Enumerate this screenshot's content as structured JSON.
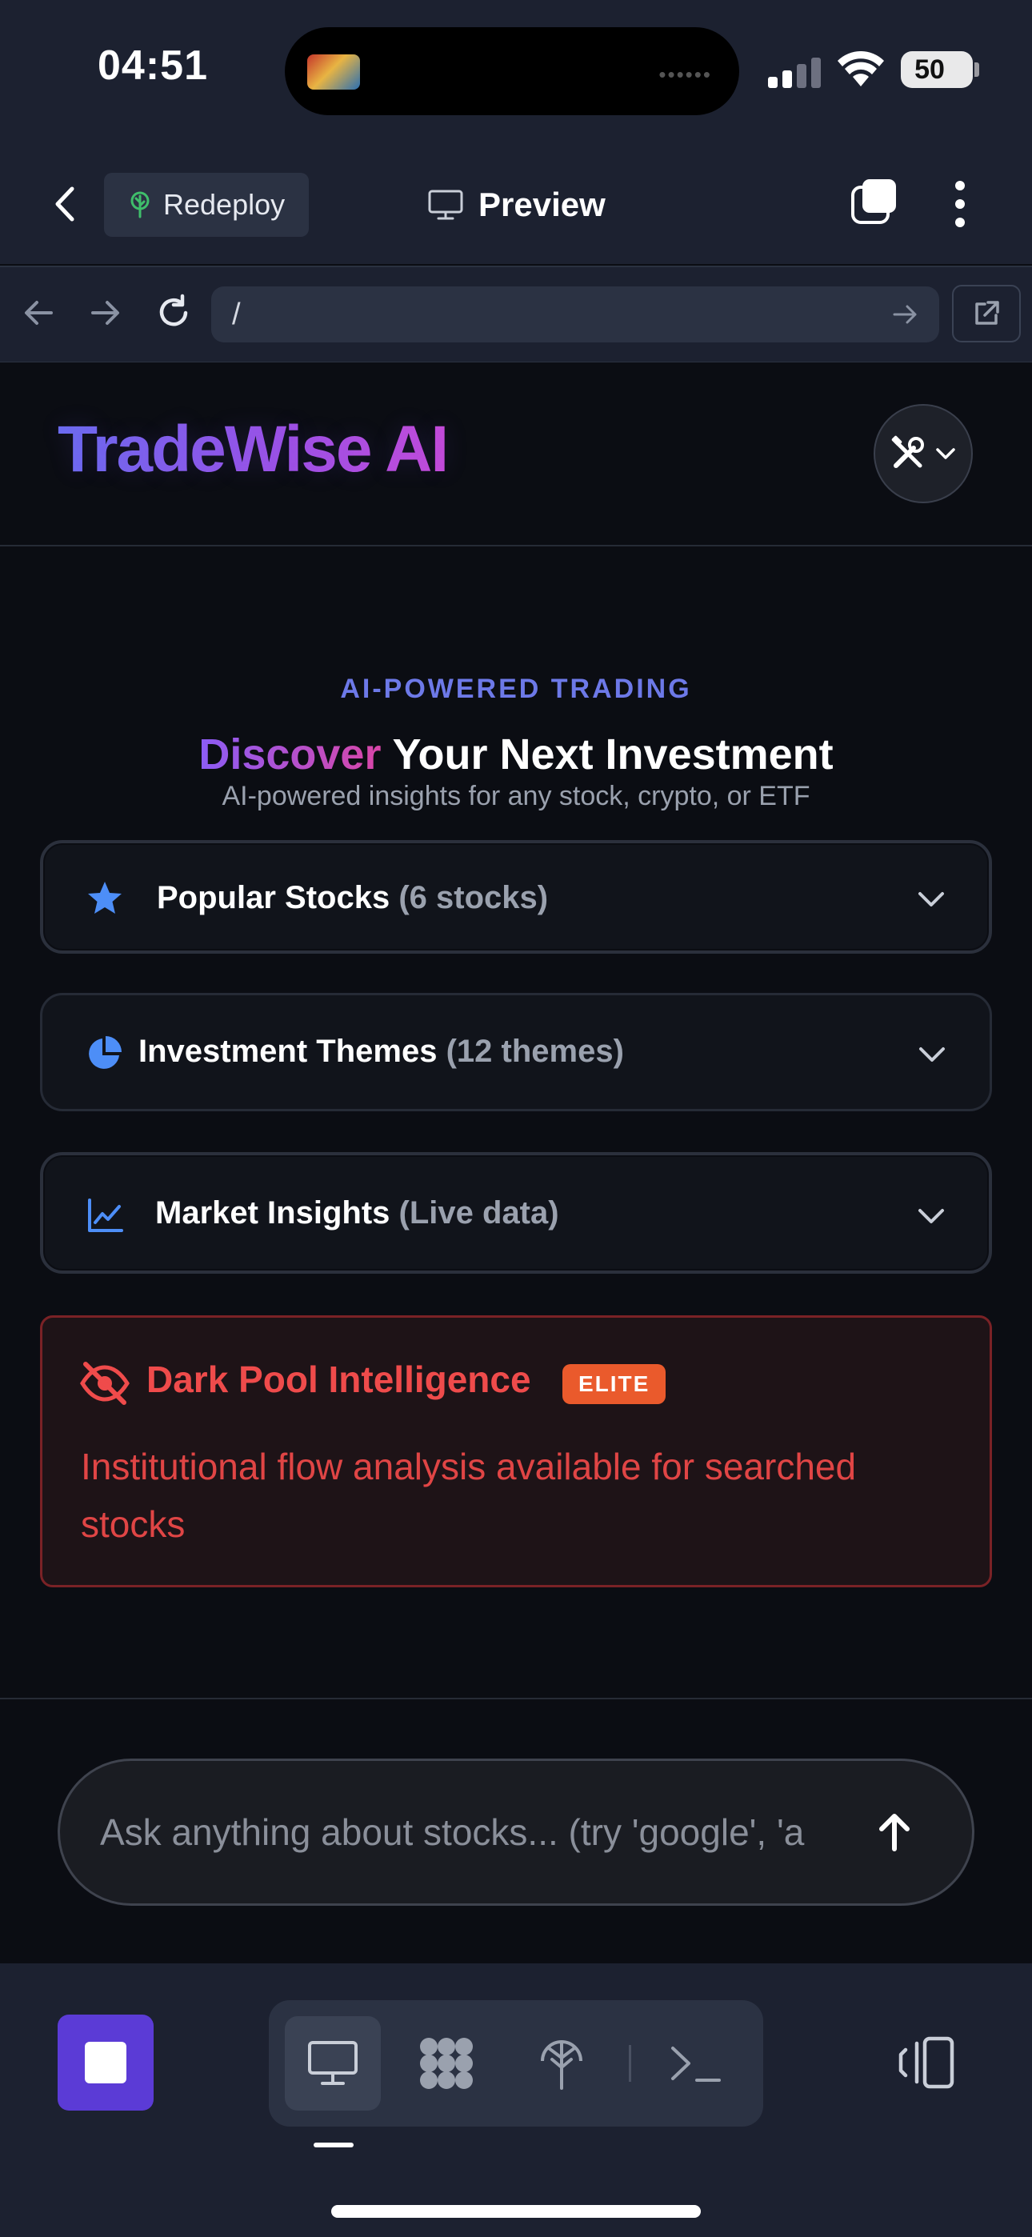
{
  "status_bar": {
    "time": "04:51",
    "battery": "50"
  },
  "app_bar": {
    "redeploy_label": "Redeploy",
    "preview_label": "Preview"
  },
  "browser": {
    "url": "/"
  },
  "app": {
    "logo": "TradeWise AI",
    "eyebrow": "AI-POWERED TRADING",
    "hero_title_accent": "Discover",
    "hero_title_rest": " Your Next Investment",
    "hero_subtitle": "AI-powered insights for any stock, crypto, or ETF"
  },
  "sections": [
    {
      "label": "Popular Stocks",
      "count": "(6 stocks)",
      "icon": "star-icon"
    },
    {
      "label": "Investment Themes",
      "count": "(12 themes)",
      "icon": "pie-chart-icon"
    },
    {
      "label": "Market Insights",
      "count": "(Live data)",
      "icon": "line-chart-icon"
    }
  ],
  "dark_pool": {
    "title": "Dark Pool Intelligence",
    "badge": "ELITE",
    "description": "Institutional flow analysis available for searched stocks"
  },
  "chat": {
    "placeholder": "Ask anything about stocks... (try 'google', 'a"
  },
  "colors": {
    "brand_start": "#6b6cf0",
    "brand_end": "#c64bd8",
    "eyebrow": "#6d79e8",
    "danger": "#ef4b4b",
    "elite_badge": "#ea5a2c",
    "stop_button": "#5b3bd6",
    "icon_blue": "#4d8ef7"
  }
}
